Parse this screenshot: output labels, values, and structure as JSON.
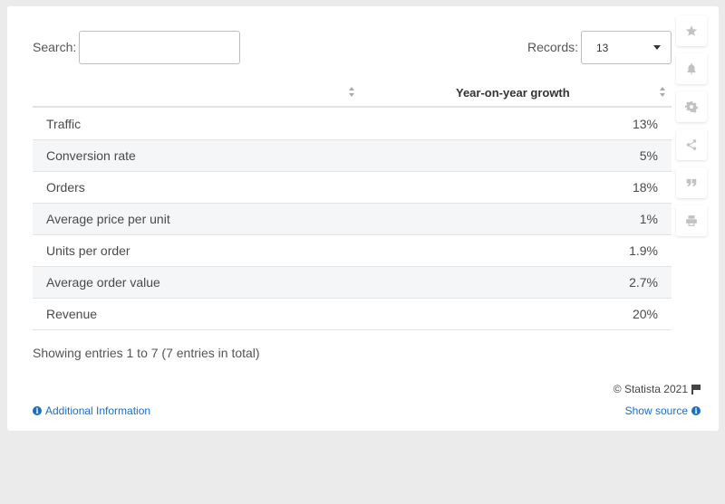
{
  "controls": {
    "search_label": "Search:",
    "search_value": "",
    "records_label": "Records:",
    "records_value": "13"
  },
  "table": {
    "columns": [
      "",
      "Year-on-year growth"
    ],
    "rows": [
      {
        "label": "Traffic",
        "value": "13%"
      },
      {
        "label": "Conversion rate",
        "value": "5%"
      },
      {
        "label": "Orders",
        "value": "18%"
      },
      {
        "label": "Average price per unit",
        "value": "1%"
      },
      {
        "label": "Units per order",
        "value": "1.9%"
      },
      {
        "label": "Average order value",
        "value": "2.7%"
      },
      {
        "label": "Revenue",
        "value": "20%"
      }
    ]
  },
  "footer": {
    "entries_info": "Showing entries 1 to 7 (7 entries in total)",
    "copyright": "© Statista 2021",
    "additional_info": "Additional Information",
    "show_source": "Show source"
  },
  "toolbar": {
    "icons": [
      "star-icon",
      "bell-icon",
      "gear-icon",
      "share-icon",
      "quote-icon",
      "print-icon"
    ]
  },
  "colors": {
    "accent": "#1a6fc4",
    "row_alt": "#f4f6f8",
    "background": "#ebebeb"
  }
}
